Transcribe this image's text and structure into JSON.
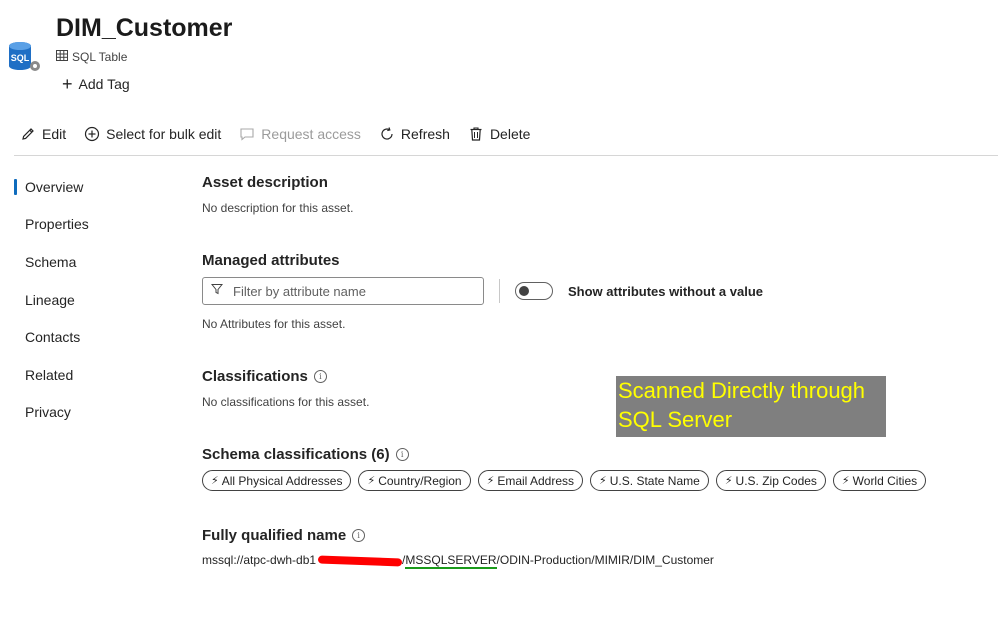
{
  "asset": {
    "title": "DIM_Customer",
    "type_label": "SQL Table",
    "icon_text": "SQL",
    "add_tag_label": "Add Tag"
  },
  "toolbar": {
    "edit": "Edit",
    "bulk_edit": "Select for bulk edit",
    "request_access": "Request access",
    "refresh": "Refresh",
    "delete": "Delete"
  },
  "nav": {
    "items": [
      {
        "label": "Overview",
        "active": true
      },
      {
        "label": "Properties"
      },
      {
        "label": "Schema"
      },
      {
        "label": "Lineage"
      },
      {
        "label": "Contacts"
      },
      {
        "label": "Related"
      },
      {
        "label": "Privacy"
      }
    ]
  },
  "sections": {
    "asset_description": {
      "heading": "Asset description",
      "text": "No description for this asset."
    },
    "managed_attributes": {
      "heading": "Managed attributes",
      "filter_placeholder": "Filter by attribute name",
      "toggle_label": "Show attributes without a value",
      "text": "No Attributes for this asset."
    },
    "classifications": {
      "heading": "Classifications",
      "text": "No classifications for this asset."
    },
    "schema_classifications": {
      "heading": "Schema classifications (6)",
      "chips": [
        "All Physical Addresses",
        "Country/Region",
        "Email Address",
        "U.S. State Name",
        "U.S. Zip Codes",
        "World Cities"
      ]
    },
    "fqn": {
      "heading": "Fully qualified name",
      "prefix": "mssql://atpc-dwh-db1",
      "redacted": "xxxxxxxxxxxx",
      "slash": "/",
      "underlined": "MSSQLSERVER",
      "suffix": "/ODIN-Production/MIMIR/DIM_Customer"
    }
  },
  "annotation": {
    "line1": "Scanned Directly through",
    "line2": "SQL Server"
  },
  "colors": {
    "accent": "#0f6cbd",
    "annotation_bg": "#7f7f7f",
    "annotation_text": "#ffff00",
    "redaction": "#ff0000",
    "underline": "#1a9a1a"
  }
}
